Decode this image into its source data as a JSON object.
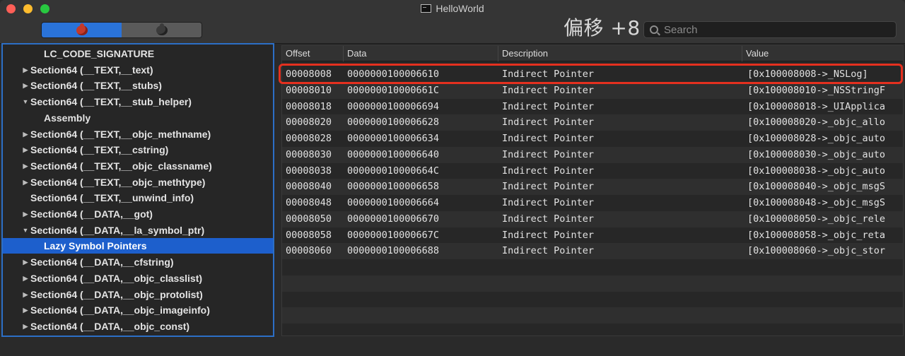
{
  "window": {
    "title": "HelloWorld",
    "annotation": "偏移 +8"
  },
  "toolbar": {
    "segments": [
      {
        "icon": "red-bug-icon",
        "selected": true
      },
      {
        "icon": "gray-bug-icon",
        "selected": false
      }
    ],
    "search": {
      "placeholder": "Search",
      "value": ""
    }
  },
  "sidebar": {
    "items": [
      {
        "label": "LC_CODE_SIGNATURE",
        "level": 1,
        "disclosure": ""
      },
      {
        "label": "Section64 (__TEXT,__text)",
        "level": 0,
        "disclosure": "▶"
      },
      {
        "label": "Section64 (__TEXT,__stubs)",
        "level": 0,
        "disclosure": "▶"
      },
      {
        "label": "Section64 (__TEXT,__stub_helper)",
        "level": 0,
        "disclosure": "▼"
      },
      {
        "label": "Assembly",
        "level": 1,
        "disclosure": ""
      },
      {
        "label": "Section64 (__TEXT,__objc_methname)",
        "level": 0,
        "disclosure": "▶"
      },
      {
        "label": "Section64 (__TEXT,__cstring)",
        "level": 0,
        "disclosure": "▶"
      },
      {
        "label": "Section64 (__TEXT,__objc_classname)",
        "level": 0,
        "disclosure": "▶"
      },
      {
        "label": "Section64 (__TEXT,__objc_methtype)",
        "level": 0,
        "disclosure": "▶"
      },
      {
        "label": "Section64 (__TEXT,__unwind_info)",
        "level": 0,
        "disclosure": ""
      },
      {
        "label": "Section64 (__DATA,__got)",
        "level": 0,
        "disclosure": "▶"
      },
      {
        "label": "Section64 (__DATA,__la_symbol_ptr)",
        "level": 0,
        "disclosure": "▼"
      },
      {
        "label": "Lazy Symbol Pointers",
        "level": 1,
        "disclosure": "",
        "selected": true
      },
      {
        "label": "Section64 (__DATA,__cfstring)",
        "level": 0,
        "disclosure": "▶"
      },
      {
        "label": "Section64 (__DATA,__objc_classlist)",
        "level": 0,
        "disclosure": "▶"
      },
      {
        "label": "Section64 (__DATA,__objc_protolist)",
        "level": 0,
        "disclosure": "▶"
      },
      {
        "label": "Section64 (__DATA,__objc_imageinfo)",
        "level": 0,
        "disclosure": "▶"
      },
      {
        "label": "Section64 (__DATA,__objc_const)",
        "level": 0,
        "disclosure": "▶"
      }
    ]
  },
  "table": {
    "columns": [
      "Offset",
      "Data",
      "Description",
      "Value"
    ],
    "rows": [
      [
        "00008008",
        "0000000100006610",
        "Indirect Pointer",
        "[0x100008008->_NSLog]"
      ],
      [
        "00008010",
        "000000010000661C",
        "Indirect Pointer",
        "[0x100008010->_NSStringF"
      ],
      [
        "00008018",
        "0000000100006694",
        "Indirect Pointer",
        "[0x100008018->_UIApplica"
      ],
      [
        "00008020",
        "0000000100006628",
        "Indirect Pointer",
        "[0x100008020->_objc_allo"
      ],
      [
        "00008028",
        "0000000100006634",
        "Indirect Pointer",
        "[0x100008028->_objc_auto"
      ],
      [
        "00008030",
        "0000000100006640",
        "Indirect Pointer",
        "[0x100008030->_objc_auto"
      ],
      [
        "00008038",
        "000000010000664C",
        "Indirect Pointer",
        "[0x100008038->_objc_auto"
      ],
      [
        "00008040",
        "0000000100006658",
        "Indirect Pointer",
        "[0x100008040->_objc_msgS"
      ],
      [
        "00008048",
        "0000000100006664",
        "Indirect Pointer",
        "[0x100008048->_objc_msgS"
      ],
      [
        "00008050",
        "0000000100006670",
        "Indirect Pointer",
        "[0x100008050->_objc_rele"
      ],
      [
        "00008058",
        "000000010000667C",
        "Indirect Pointer",
        "[0x100008058->_objc_reta"
      ],
      [
        "00008060",
        "0000000100006688",
        "Indirect Pointer",
        "[0x100008060->_objc_stor"
      ]
    ],
    "highlighted_row": 0,
    "highlight_color": "#e5301f"
  },
  "colors": {
    "accent": "#2c6fc6",
    "selection": "#1d5fcc"
  }
}
